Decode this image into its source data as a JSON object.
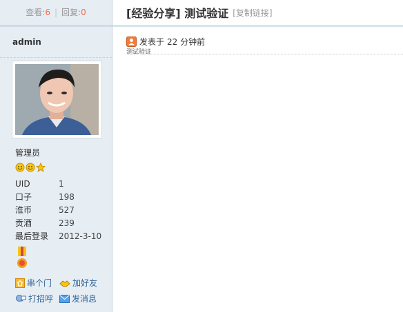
{
  "stats": {
    "views_label": "查看:",
    "views": "6",
    "replies_label": "回复:",
    "replies": "0",
    "sep": "|"
  },
  "user": {
    "name": "admin",
    "group": "管理员",
    "info": [
      {
        "key": "UID",
        "value": "1"
      },
      {
        "key": "口子",
        "value": "198"
      },
      {
        "key": "淮币",
        "value": "527"
      },
      {
        "key": "贡酒",
        "value": "239"
      },
      {
        "key": "最后登录",
        "value": "2012-3-10"
      }
    ],
    "actions": {
      "visit": "串个门",
      "add_friend": "加好友",
      "greet": "打招呼",
      "message": "发消息"
    }
  },
  "thread": {
    "category": "[经验分享]",
    "title": "测试验证",
    "copy_link": "[复制链接]"
  },
  "post": {
    "posted": "发表于",
    "time": "22 分钟前",
    "body": "测试验证"
  },
  "colors": {
    "accent": "#f26c4f",
    "link": "#336699",
    "sidebar": "#e6edf3"
  }
}
